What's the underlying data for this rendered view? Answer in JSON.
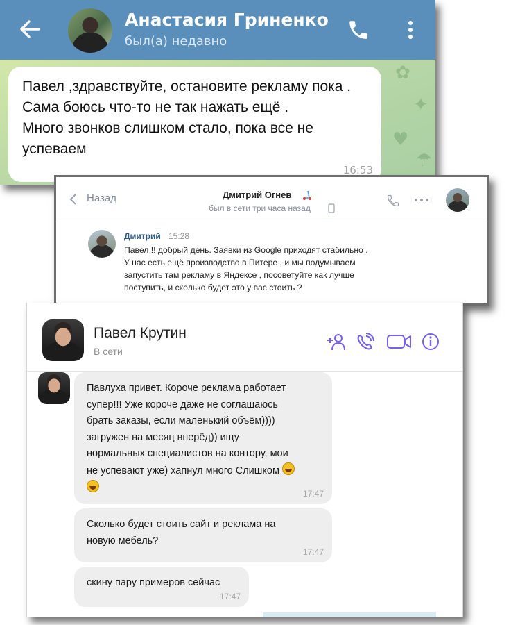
{
  "telegram": {
    "contact_name": "Анастасия Гриненко",
    "status": "был(а) недавно",
    "message": {
      "text": " Павел ,здравствуйте,  остановите рекламу пока .\n Сама боюсь что-то не так нажать ещё .\nМного звонков слишком стало, пока все не успеваем",
      "time": "16:53"
    },
    "colors": {
      "header": "#5a8fbb",
      "bubble": "#ffffff"
    },
    "icons": [
      "back-arrow-icon",
      "phone-icon",
      "more-vertical-icon"
    ]
  },
  "vk": {
    "back_label": "Назад",
    "contact_name": "Дмитрий Огнев",
    "status": "был в сети три часа назад",
    "message": {
      "author": "Дмитрий",
      "time": "15:28",
      "text": "Павел !!  добрый день. Заявки из Google приходят стабильно .\nУ нас есть ещё производство в Питере , и мы подумываем\nзапустить там рекламу в Яндексе , посоветуйте как лучше\nпоступить, и сколько будет это у вас стоить ?"
    },
    "colors": {
      "author": "#2a5885"
    },
    "icons": [
      "chevron-left-icon",
      "scooter-icon",
      "mobile-phone-icon",
      "phone-icon",
      "more-horizontal-icon"
    ]
  },
  "viber": {
    "contact_name": "Павел Крутин",
    "status": "В сети",
    "messages": [
      {
        "text": "Павлуха привет. Короче реклама работает\nсупер!!! Уже короче даже не соглашаюсь\nбрать заказы, если маленький объём))))\nзагружен на месяц вперёд)) ищу\nнормальных специалистов на контору, мои\nне успевают уже) хапнул много Слишком",
        "time": "17:47",
        "emoji": "rolling-laughing-emoji"
      },
      {
        "text": "Сколько будет стоить сайт и реклама на\nновую мебель?",
        "time": "17:47"
      },
      {
        "text": "скину пару примеров сейчас",
        "time": "17:47"
      }
    ],
    "colors": {
      "accent": "#7360f2",
      "bubble": "#eeeeee"
    },
    "icons": [
      "add-participant-icon",
      "call-icon",
      "video-call-icon",
      "info-icon"
    ]
  }
}
